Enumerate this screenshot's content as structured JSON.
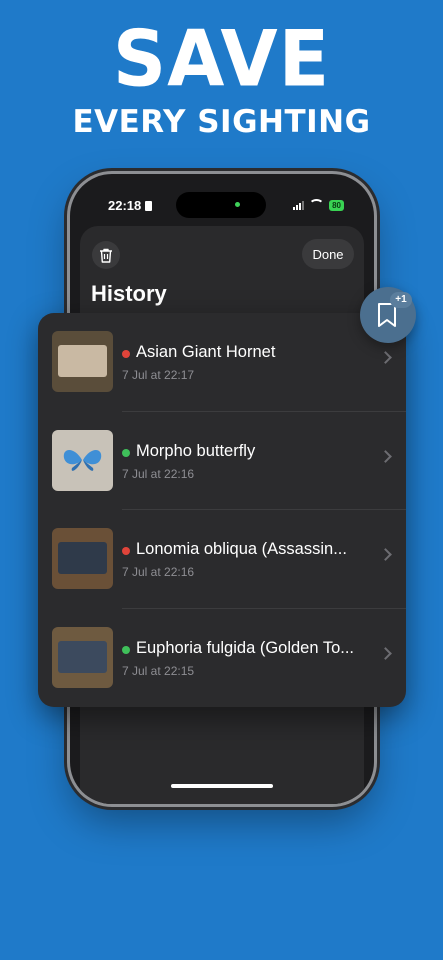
{
  "headline": {
    "line1": "SAVE",
    "line2": "EVERY SIGHTING"
  },
  "status_bar": {
    "time": "22:18",
    "battery": "80"
  },
  "header": {
    "title": "History",
    "done_label": "Done"
  },
  "history": [
    {
      "title": "Asian Giant Hornet",
      "time": "7 Jul at 22:17",
      "status_color": "#e0443a",
      "thumb_bg": "#5a4d3a",
      "screen_color": "#c9b9a3"
    },
    {
      "title": "Morpho butterfly",
      "time": "7 Jul at 22:16",
      "status_color": "#3fc05a",
      "thumb_bg": "#c8c2b8",
      "screen_color": "#e9e6e0"
    },
    {
      "title": "Lonomia obliqua (Assassin...",
      "time": "7 Jul at 22:16",
      "status_color": "#e0443a",
      "thumb_bg": "#6a5037",
      "screen_color": "#2f3a4a"
    },
    {
      "title": "Euphoria fulgida (Golden To...",
      "time": "7 Jul at 22:15",
      "status_color": "#3fc05a",
      "thumb_bg": "#6e5a40",
      "screen_color": "#3c4a5e"
    }
  ],
  "bookmark_badge": "+1",
  "colors": {
    "background": "#1f7ac9",
    "sheet": "#2b2b2d"
  }
}
